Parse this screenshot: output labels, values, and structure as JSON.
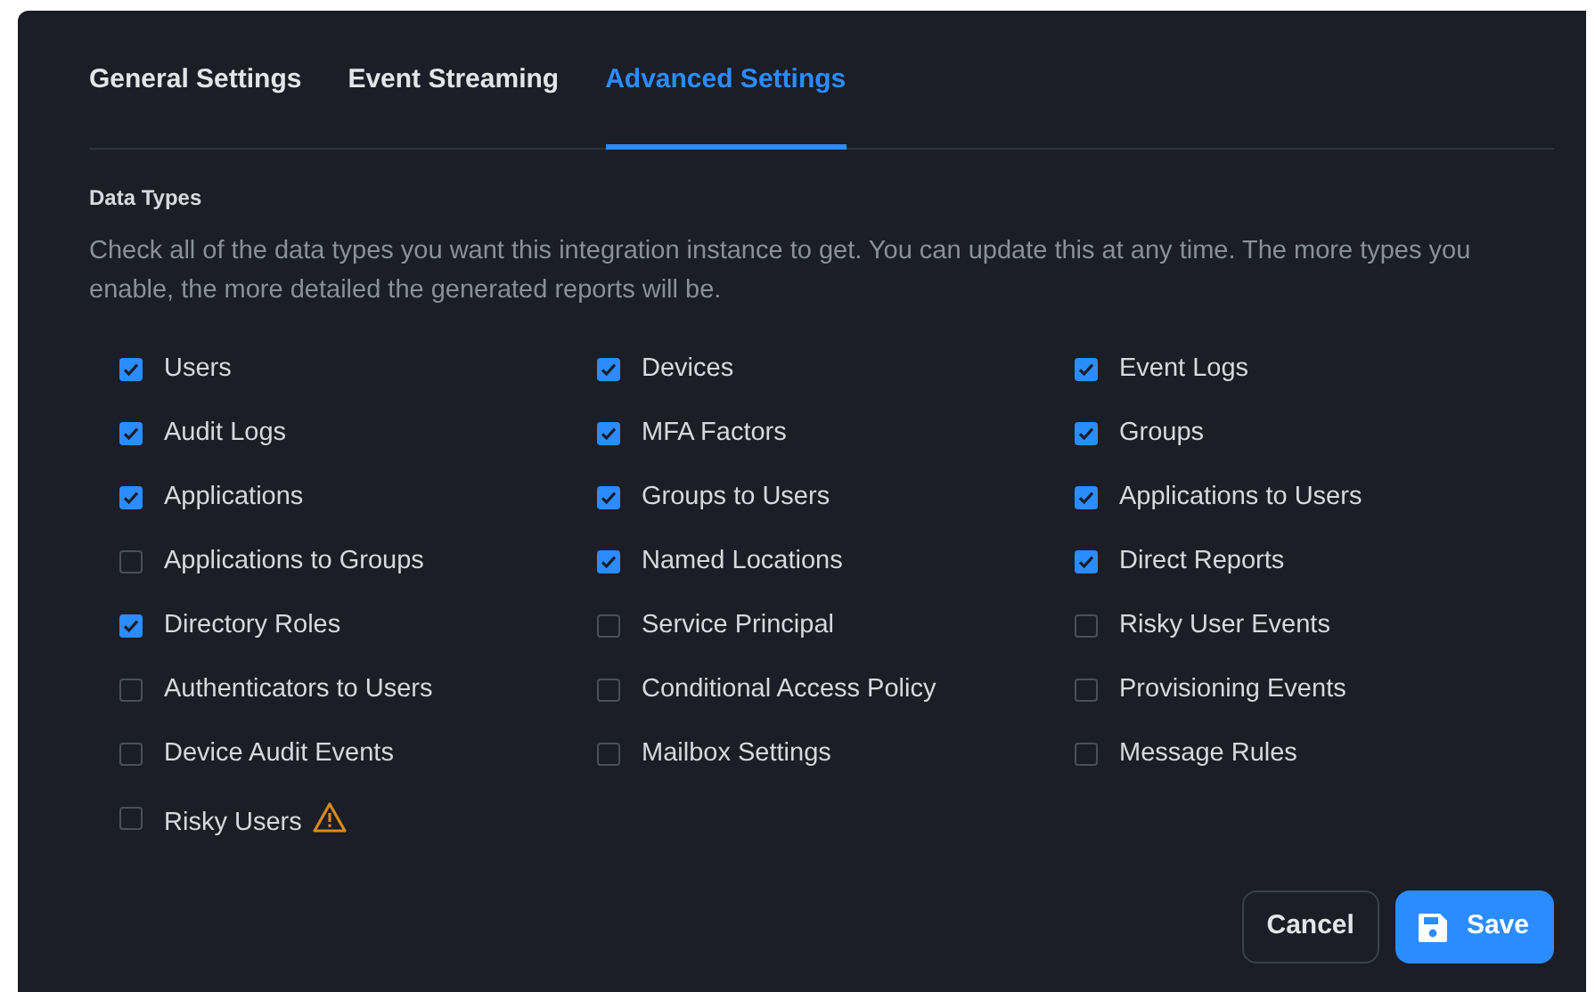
{
  "tabs": [
    {
      "label": "General Settings",
      "selected": false
    },
    {
      "label": "Event Streaming",
      "selected": false
    },
    {
      "label": "Advanced Settings",
      "selected": true
    }
  ],
  "section": {
    "title": "Data Types",
    "description": "Check all of the data types you want this integration instance to get. You can update this at any time. The more types you enable, the more detailed the generated reports will be."
  },
  "data_types": [
    {
      "label": "Users",
      "checked": true,
      "warning": false
    },
    {
      "label": "Devices",
      "checked": true,
      "warning": false
    },
    {
      "label": "Event Logs",
      "checked": true,
      "warning": false
    },
    {
      "label": "Audit Logs",
      "checked": true,
      "warning": false
    },
    {
      "label": "MFA Factors",
      "checked": true,
      "warning": false
    },
    {
      "label": "Groups",
      "checked": true,
      "warning": false
    },
    {
      "label": "Applications",
      "checked": true,
      "warning": false
    },
    {
      "label": "Groups to Users",
      "checked": true,
      "warning": false
    },
    {
      "label": "Applications to Users",
      "checked": true,
      "warning": false
    },
    {
      "label": "Applications to Groups",
      "checked": false,
      "warning": false
    },
    {
      "label": "Named Locations",
      "checked": true,
      "warning": false
    },
    {
      "label": "Direct Reports",
      "checked": true,
      "warning": false
    },
    {
      "label": "Directory Roles",
      "checked": true,
      "warning": false
    },
    {
      "label": "Service Principal",
      "checked": false,
      "warning": false
    },
    {
      "label": "Risky User Events",
      "checked": false,
      "warning": false
    },
    {
      "label": "Authenticators to Users",
      "checked": false,
      "warning": false
    },
    {
      "label": "Conditional Access Policy",
      "checked": false,
      "warning": false
    },
    {
      "label": "Provisioning Events",
      "checked": false,
      "warning": false
    },
    {
      "label": "Device Audit Events",
      "checked": false,
      "warning": false
    },
    {
      "label": "Mailbox Settings",
      "checked": false,
      "warning": false
    },
    {
      "label": "Message Rules",
      "checked": false,
      "warning": false
    },
    {
      "label": "Risky Users",
      "checked": false,
      "warning": true
    }
  ],
  "buttons": {
    "cancel": "Cancel",
    "save": "Save"
  }
}
